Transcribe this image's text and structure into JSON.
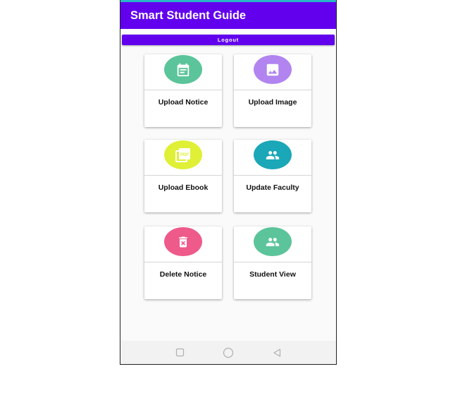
{
  "app": {
    "title": "Smart Student Guide"
  },
  "header": {
    "logout_label": "Logout"
  },
  "colors": {
    "primary": "#6200ee",
    "notice": "#5cc49a",
    "image": "#b184f0",
    "ebook": "#dff036",
    "faculty": "#1aa7b8",
    "delete": "#ee5a8a",
    "student_view": "#5cc49a"
  },
  "cards": [
    {
      "label": "Upload Notice",
      "icon": "calendar-icon"
    },
    {
      "label": "Upload Image",
      "icon": "image-icon"
    },
    {
      "label": "Upload Ebook",
      "icon": "pdf-icon"
    },
    {
      "label": "Update Faculty",
      "icon": "people-icon"
    },
    {
      "label": "Delete Notice",
      "icon": "trash-icon"
    },
    {
      "label": "Student View",
      "icon": "people-icon"
    }
  ],
  "nav": {
    "buttons": [
      "recents",
      "home",
      "back"
    ]
  }
}
